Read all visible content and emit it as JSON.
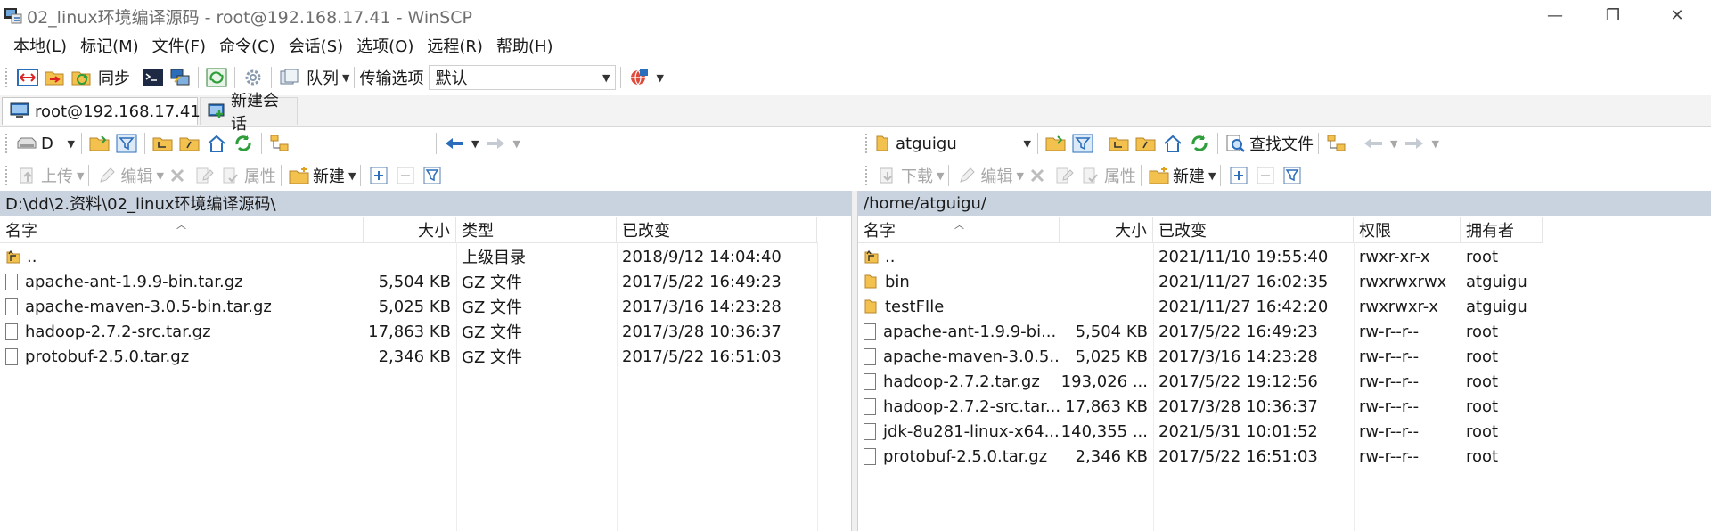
{
  "window": {
    "title": "02_linux环境编译源码 - root@192.168.17.41 - WinSCP",
    "minimize_glyph": "—",
    "restore_glyph": "❐",
    "close_glyph": "✕"
  },
  "menu": [
    "本地(L)",
    "标记(M)",
    "文件(F)",
    "命令(C)",
    "会话(S)",
    "选项(O)",
    "远程(R)",
    "帮助(H)"
  ],
  "toolbar": {
    "sync_label": "同步",
    "queue_label": "队列",
    "transfer_options_label": "传输选项",
    "transfer_preset_value": "默认"
  },
  "tabs": {
    "session": "root@192.168.17.41",
    "new_session": "新建会话"
  },
  "left": {
    "drive": "D",
    "upload_label": "上传",
    "edit_label": "编辑",
    "properties_label": "属性",
    "new_label": "新建",
    "path": "D:\\dd\\2.资料\\02_linux环境编译源码\\",
    "columns": {
      "name": "名字",
      "size": "大小",
      "type": "类型",
      "modified": "已改变"
    },
    "rows": [
      {
        "icon": "parent-dir-icon",
        "name": "..",
        "size": "",
        "type": "上级目录",
        "modified": "2018/9/12  14:04:40"
      },
      {
        "icon": "file-icon",
        "name": "apache-ant-1.9.9-bin.tar.gz",
        "size": "5,504 KB",
        "type": "GZ 文件",
        "modified": "2017/5/22  16:49:23"
      },
      {
        "icon": "file-icon",
        "name": "apache-maven-3.0.5-bin.tar.gz",
        "size": "5,025 KB",
        "type": "GZ 文件",
        "modified": "2017/3/16  14:23:28"
      },
      {
        "icon": "file-icon",
        "name": "hadoop-2.7.2-src.tar.gz",
        "size": "17,863 KB",
        "type": "GZ 文件",
        "modified": "2017/3/28  10:36:37"
      },
      {
        "icon": "file-icon",
        "name": "protobuf-2.5.0.tar.gz",
        "size": "2,346 KB",
        "type": "GZ 文件",
        "modified": "2017/5/22  16:51:03"
      }
    ]
  },
  "right": {
    "folder": "atguigu",
    "find_files_label": "查找文件",
    "download_label": "下载",
    "edit_label": "编辑",
    "properties_label": "属性",
    "new_label": "新建",
    "path": "/home/atguigu/",
    "columns": {
      "name": "名字",
      "size": "大小",
      "modified": "已改变",
      "rights": "权限",
      "owner": "拥有者"
    },
    "rows": [
      {
        "icon": "parent-dir-icon",
        "name": "..",
        "size": "",
        "modified": "2021/11/10 19:55:40",
        "rights": "rwxr-xr-x",
        "owner": "root"
      },
      {
        "icon": "folder-icon",
        "name": "bin",
        "size": "",
        "modified": "2021/11/27 16:02:35",
        "rights": "rwxrwxrwx",
        "owner": "atguigu"
      },
      {
        "icon": "folder-icon",
        "name": "testFIle",
        "size": "",
        "modified": "2021/11/27 16:42:20",
        "rights": "rwxrwxr-x",
        "owner": "atguigu"
      },
      {
        "icon": "file-icon",
        "name": "apache-ant-1.9.9-bi...",
        "size": "5,504 KB",
        "modified": "2017/5/22 16:49:23",
        "rights": "rw-r--r--",
        "owner": "root"
      },
      {
        "icon": "file-icon",
        "name": "apache-maven-3.0.5...",
        "size": "5,025 KB",
        "modified": "2017/3/16 14:23:28",
        "rights": "rw-r--r--",
        "owner": "root"
      },
      {
        "icon": "file-icon",
        "name": "hadoop-2.7.2.tar.gz",
        "size": "193,026 ...",
        "modified": "2017/5/22 19:12:56",
        "rights": "rw-r--r--",
        "owner": "root"
      },
      {
        "icon": "file-icon",
        "name": "hadoop-2.7.2-src.tar...",
        "size": "17,863 KB",
        "modified": "2017/3/28 10:36:37",
        "rights": "rw-r--r--",
        "owner": "root"
      },
      {
        "icon": "file-icon",
        "name": "jdk-8u281-linux-x64...",
        "size": "140,355 ...",
        "modified": "2021/5/31 10:01:52",
        "rights": "rw-r--r--",
        "owner": "root"
      },
      {
        "icon": "file-icon",
        "name": "protobuf-2.5.0.tar.gz",
        "size": "2,346 KB",
        "modified": "2017/5/22 16:51:03",
        "rights": "rw-r--r--",
        "owner": "root"
      }
    ]
  },
  "colors": {
    "path_bar": "#c9d3df",
    "folder": "#f2c14e",
    "accent_blue": "#2a6ebb",
    "accent_green": "#2e9e3a"
  }
}
